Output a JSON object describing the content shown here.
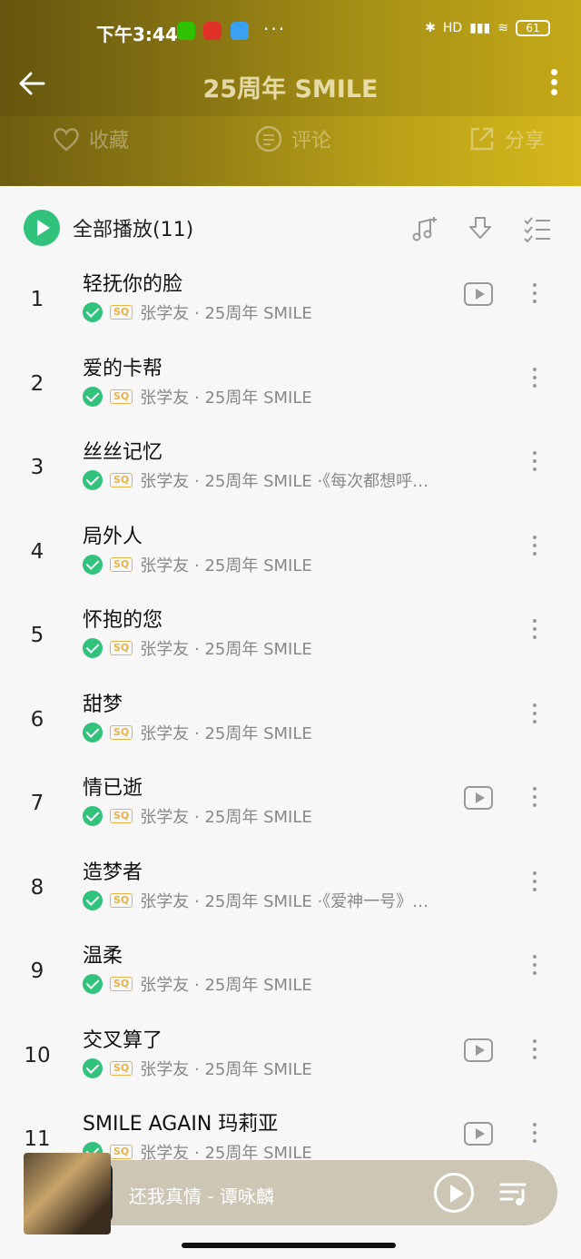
{
  "status_bar": {
    "time": "下午3:44",
    "battery": "61",
    "signal_label": "HD"
  },
  "nav": {
    "title": "25周年 SMILE"
  },
  "actions": [
    {
      "label": "收藏",
      "icon": "heart-icon"
    },
    {
      "label": "评论",
      "icon": "comment-icon"
    },
    {
      "label": "分享",
      "icon": "share-icon"
    }
  ],
  "list_header": {
    "play_all_label": "全部播放(11)"
  },
  "songs": [
    {
      "no": "1",
      "title": "轻抚你的脸",
      "meta": "张学友 · 25周年 SMILE",
      "mv": true
    },
    {
      "no": "2",
      "title": "爱的卡帮",
      "meta": "张学友 · 25周年 SMILE",
      "mv": false
    },
    {
      "no": "3",
      "title": "丝丝记忆",
      "meta": "张学友 · 25周年 SMILE ·《每次都想呼…",
      "mv": false
    },
    {
      "no": "4",
      "title": "局外人",
      "meta": "张学友 · 25周年 SMILE",
      "mv": false
    },
    {
      "no": "5",
      "title": "怀抱的您",
      "meta": "张学友 · 25周年 SMILE",
      "mv": false
    },
    {
      "no": "6",
      "title": "甜梦",
      "meta": "张学友 · 25周年 SMILE",
      "mv": false
    },
    {
      "no": "7",
      "title": "情已逝",
      "meta": "张学友 · 25周年 SMILE",
      "mv": true
    },
    {
      "no": "8",
      "title": "造梦者",
      "meta": "张学友 · 25周年 SMILE ·《爱神一号》…",
      "mv": false
    },
    {
      "no": "9",
      "title": "温柔",
      "meta": "张学友 · 25周年 SMILE",
      "mv": false
    },
    {
      "no": "10",
      "title": "交叉算了",
      "meta": "张学友 · 25周年 SMILE",
      "mv": true
    },
    {
      "no": "11",
      "title": "SMILE AGAIN 玛莉亚",
      "meta": "张学友 · 25周年 SMILE",
      "mv": true
    }
  ],
  "sq_label": "SQ",
  "player": {
    "now_playing": "还我真情 - 谭咏麟"
  },
  "colors": {
    "accent_green": "#31c27c",
    "header_gold": "#d6b81c",
    "sq_orange": "#e8b44a"
  }
}
